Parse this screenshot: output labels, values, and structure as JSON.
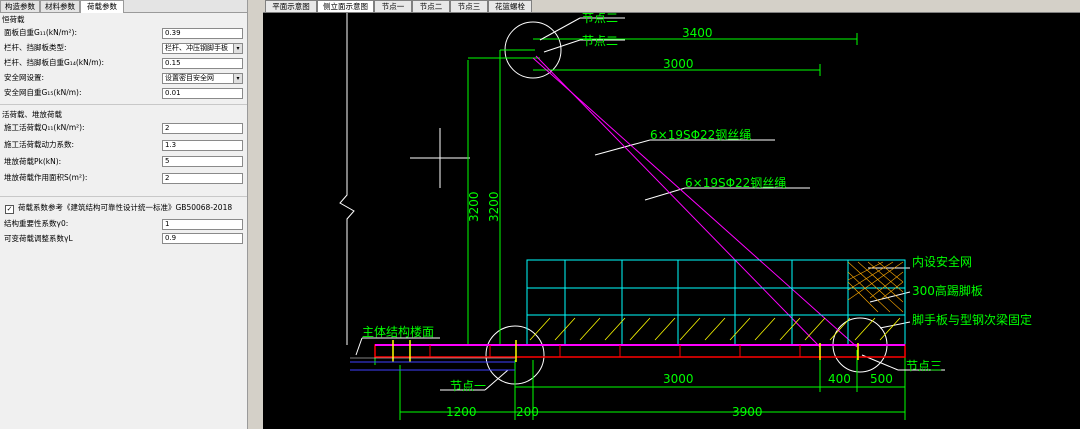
{
  "left_tabs": [
    "构造参数",
    "材料参数",
    "荷载参数"
  ],
  "sections": {
    "dead": "恒荷载",
    "live": "活荷载、堆放荷载"
  },
  "fields": [
    {
      "label": "面板自重G₁₁(kN/m²):",
      "value": "0.39",
      "type": "input"
    },
    {
      "label": "栏杆、挡脚板类型:",
      "value": "栏杆、冲压钢脚手板",
      "type": "select"
    },
    {
      "label": "栏杆、挡脚板自重G₁₄(kN/m):",
      "value": "0.15",
      "type": "input"
    },
    {
      "label": "安全网设置:",
      "value": "设置密目安全网",
      "type": "select"
    },
    {
      "label": "安全网自重G₁₅(kN/m):",
      "value": "0.01",
      "type": "input"
    },
    {
      "label": "施工活荷载Q₁₁(kN/m²):",
      "value": "2",
      "type": "input"
    },
    {
      "label": "施工活荷载动力系数:",
      "value": "1.3",
      "type": "input"
    },
    {
      "label": "堆放荷载Pk(kN):",
      "value": "5",
      "type": "input"
    },
    {
      "label": "堆放荷载作用面积S(m²):",
      "value": "2",
      "type": "input"
    },
    {
      "label": "结构重要性系数γ0:",
      "value": "1",
      "type": "input"
    },
    {
      "label": "可变荷载调整系数γL",
      "value": "0.9",
      "type": "input"
    }
  ],
  "checkbox": {
    "label": "荷载系数参考《建筑结构可靠性设计统一标准》GB50068-2018",
    "checked": true
  },
  "view_tabs": [
    "平面示意图",
    "侧立面示意图",
    "节点一",
    "节点二",
    "节点三",
    "花篮螺栓"
  ],
  "drawing": {
    "labels": {
      "node2a": "节点二",
      "node2b": "节点二",
      "node1": "节点一",
      "node3": "节点三",
      "rope1": "6×19SΦ22钢丝绳",
      "rope2": "6×19SΦ22钢丝绳",
      "net": "内设安全网",
      "board": "300高踢脚板",
      "fix": "脚手板与型钢次梁固定",
      "floor": "主体结构楼面"
    },
    "dims": {
      "d3400": "3400",
      "d3000top": "3000",
      "d3200a": "3200",
      "d3200b": "3200",
      "d3000": "3000",
      "d400": "400",
      "d500": "500",
      "d1200": "1200",
      "d200": "200",
      "d3900": "3900"
    },
    "colors": {
      "line": "#00ff00",
      "text": "#00ff00",
      "beam": "#ff0000",
      "rope": "#ff00ff",
      "rail": "#00ffff",
      "hatch": "#ffff00",
      "white": "#ffffff"
    }
  }
}
